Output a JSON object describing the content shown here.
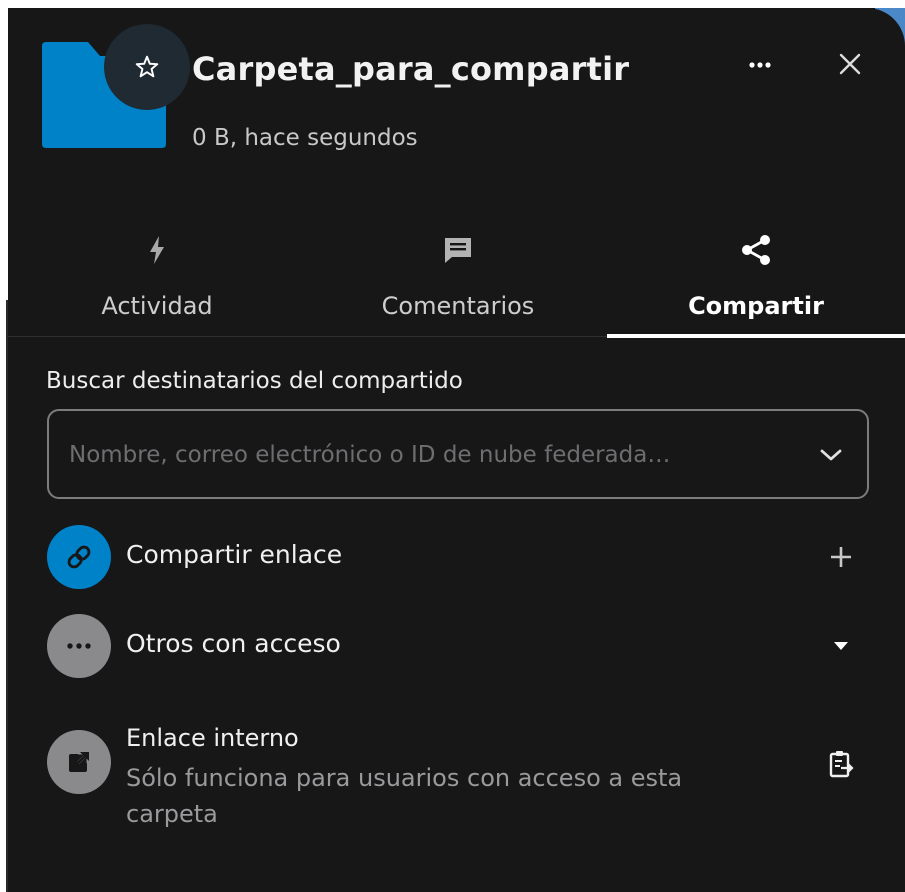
{
  "header": {
    "title": "Carpeta_para_compartir",
    "subtitle": "0 B, hace segundos",
    "folder_color": "#0082c9",
    "favorite_icon": "star-icon",
    "more_icon": "more-horizontal-icon",
    "close_icon": "close-icon"
  },
  "tabs": [
    {
      "label": "Actividad",
      "icon": "lightning-icon",
      "active": false
    },
    {
      "label": "Comentarios",
      "icon": "comment-icon",
      "active": false
    },
    {
      "label": "Compartir",
      "icon": "share-icon",
      "active": true
    }
  ],
  "search": {
    "label": "Buscar destinatarios del compartido",
    "placeholder": "Nombre, correo electrónico o ID de nube federada…"
  },
  "share_link": {
    "label": "Compartir enlace",
    "icon": "link-icon",
    "action_icon": "plus-icon",
    "accent": "#0082c9"
  },
  "others_access": {
    "label": "Otros con acceso",
    "icon": "more-horizontal-icon",
    "action_icon": "triangle-down-icon"
  },
  "internal_link": {
    "title": "Enlace interno",
    "description": "Sólo funciona para usuarios con acceso a esta carpeta",
    "icon": "open-in-new-icon",
    "action_icon": "clipboard-copy-icon"
  }
}
